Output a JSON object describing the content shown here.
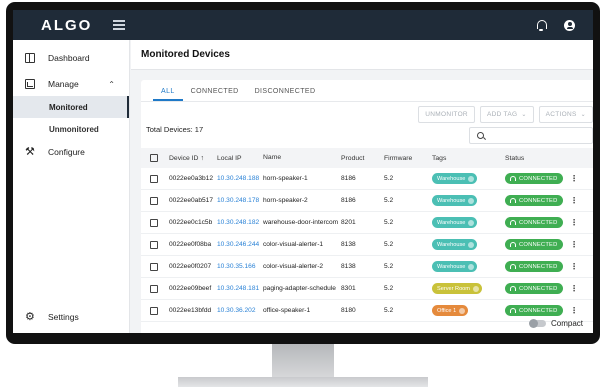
{
  "app": {
    "logo": "ALGO"
  },
  "sidebar": {
    "items": [
      {
        "label": "Dashboard",
        "icon": "dashboard-icon"
      },
      {
        "label": "Manage",
        "icon": "manage-icon",
        "expanded": true,
        "children": [
          {
            "label": "Monitored",
            "active": true
          },
          {
            "label": "Unmonitored"
          }
        ]
      },
      {
        "label": "Configure",
        "icon": "tools-icon"
      }
    ],
    "settings_label": "Settings"
  },
  "page": {
    "title": "Monitored Devices"
  },
  "tabs": [
    {
      "label": "ALL",
      "active": true
    },
    {
      "label": "CONNECTED"
    },
    {
      "label": "DISCONNECTED"
    }
  ],
  "actions": {
    "unmonitor": "UNMONITOR",
    "add_tag": "ADD TAG",
    "actions": "ACTIONS"
  },
  "total_devices": "Total Devices: 17",
  "search": {
    "placeholder": ""
  },
  "table": {
    "headers": {
      "device_id": "Device ID",
      "local_ip": "Local IP",
      "name": "Name",
      "product": "Product",
      "firmware": "Firmware",
      "tags": "Tags",
      "status": "Status"
    },
    "rows": [
      {
        "device_id": "0022ee0a3b12",
        "local_ip": "10.30.248.188",
        "name": "horn-speaker-1",
        "product": "8186",
        "firmware": "5.2",
        "tag": "Warehouse",
        "tag_color": "#4bbfb4",
        "status": "CONNECTED"
      },
      {
        "device_id": "0022ee0ab517",
        "local_ip": "10.30.248.178",
        "name": "horn-speaker-2",
        "product": "8186",
        "firmware": "5.2",
        "tag": "Warehouse",
        "tag_color": "#4bbfb4",
        "status": "CONNECTED"
      },
      {
        "device_id": "0022ee0c1c5b",
        "local_ip": "10.30.248.182",
        "name": "warehouse-door-intercom",
        "product": "8201",
        "firmware": "5.2",
        "tag": "Warehouse",
        "tag_color": "#4bbfb4",
        "status": "CONNECTED"
      },
      {
        "device_id": "0022ee0f08ba",
        "local_ip": "10.30.246.244",
        "name": "color-visual-alerter-1",
        "product": "8138",
        "firmware": "5.2",
        "tag": "Warehouse",
        "tag_color": "#4bbfb4",
        "status": "CONNECTED"
      },
      {
        "device_id": "0022ee0f0207",
        "local_ip": "10.30.35.166",
        "name": "color-visual-alerter-2",
        "product": "8138",
        "firmware": "5.2",
        "tag": "Warehouse",
        "tag_color": "#4bbfb4",
        "status": "CONNECTED"
      },
      {
        "device_id": "0022ee09beef",
        "local_ip": "10.30.248.181",
        "name": "paging-adapter-schedule",
        "product": "8301",
        "firmware": "5.2",
        "tag": "Server Room",
        "tag_color": "#c9c23a",
        "status": "CONNECTED"
      },
      {
        "device_id": "0022ee13bfdd",
        "local_ip": "10.30.36.202",
        "name": "office-speaker-1",
        "product": "8180",
        "firmware": "5.2",
        "tag": "Office 1",
        "tag_color": "#e58a3c",
        "status": "CONNECTED"
      }
    ]
  },
  "compact_label": "Compact",
  "colors": {
    "topbar": "#1f2b38",
    "accent": "#1f79c7",
    "connected": "#3fae52"
  }
}
